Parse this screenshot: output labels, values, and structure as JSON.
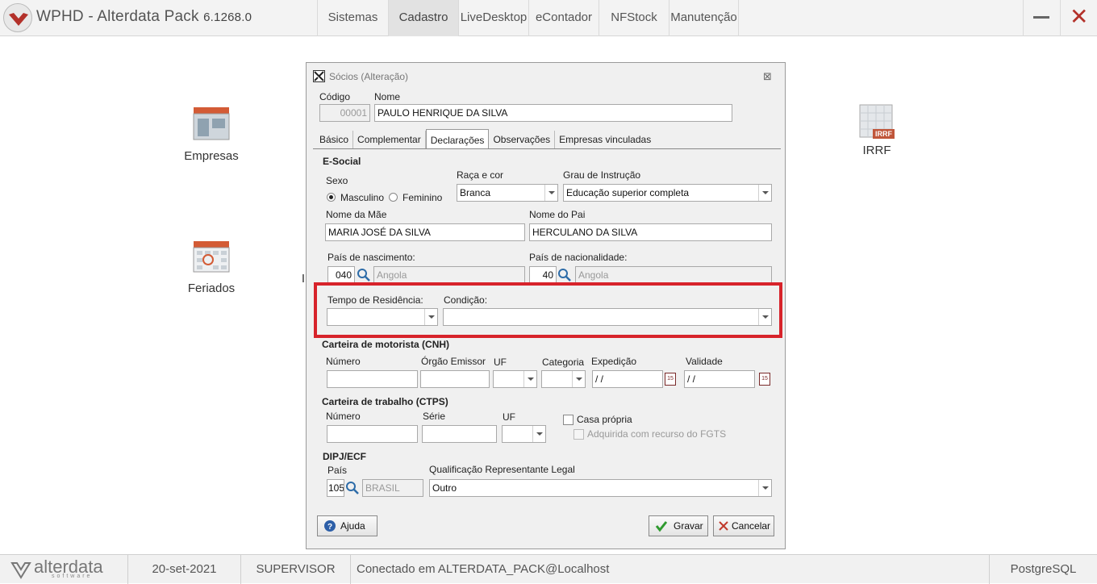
{
  "app": {
    "title": "WPHD - Alterdata Pack",
    "version": "6.1268.0",
    "brand_color": "#b3312a"
  },
  "menu": [
    "Sistemas",
    "Cadastro",
    "LiveDesktop",
    "eContador",
    "NFStock",
    "Manutenção"
  ],
  "menu_active": "Cadastro",
  "desktop_icons": {
    "empresas": "Empresas",
    "feriados": "Feriados",
    "irrf": "IRRF",
    "irrf_badge": "IRRF",
    "partial": "I"
  },
  "dialog": {
    "title": "Sócios (Alteração)",
    "codigo_label": "Código",
    "codigo_value": "00001",
    "nome_label": "Nome",
    "nome_value": "PAULO HENRIQUE DA SILVA",
    "tabs": [
      "Básico",
      "Complementar",
      "Declarações",
      "Observações",
      "Empresas vinculadas"
    ],
    "active_tab": "Declarações",
    "esocial": {
      "section": "E-Social",
      "sexo_label": "Sexo",
      "sexo_options": [
        "Masculino",
        "Feminino"
      ],
      "sexo_selected": "Masculino",
      "raca_label": "Raça e cor",
      "raca_value": "Branca",
      "grau_label": "Grau de Instrução",
      "grau_value": "Educação superior completa",
      "mae_label": "Nome da Mãe",
      "mae_value": "MARIA JOSÉ DA SILVA",
      "pai_label": "Nome do Pai",
      "pai_value": "HERCULANO DA SILVA",
      "pais_nasc_label": "País de nascimento:",
      "pais_nasc_code": "040",
      "pais_nasc_name": "Angola",
      "pais_nac_label": "País de nacionalidade:",
      "pais_nac_code": "40",
      "pais_nac_name": "Angola",
      "tempo_label": "Tempo de Residência:",
      "tempo_value": "",
      "condicao_label": "Condição:",
      "condicao_value": ""
    },
    "cnh": {
      "section": "Carteira de motorista (CNH)",
      "numero_label": "Número",
      "orgao_label": "Órgão Emissor",
      "uf_label": "UF",
      "categoria_label": "Categoria",
      "expedicao_label": "Expedição",
      "expedicao_value": " / /",
      "validade_label": "Validade",
      "validade_value": " / /",
      "cal_glyph": "15"
    },
    "ctps": {
      "section": "Carteira de trabalho (CTPS)",
      "numero_label": "Número",
      "serie_label": "Série",
      "uf_label": "UF",
      "casa_propria_label": "Casa própria",
      "fgts_label": "Adquirida com recurso do FGTS"
    },
    "dipj": {
      "section": "DIPJ/ECF",
      "pais_label": "País",
      "pais_code": "105",
      "pais_name": "BRASIL",
      "qualif_label": "Qualificação Representante Legal",
      "qualif_value": "Outro"
    },
    "buttons": {
      "ajuda": "Ajuda",
      "gravar": "Gravar",
      "cancelar": "Cancelar"
    },
    "highlight_color": "#d7232b"
  },
  "statusbar": {
    "logo_text": "alterdata",
    "logo_sub": "software",
    "date": "20-set-2021",
    "user": "SUPERVISOR",
    "connection": "Conectado em ALTERDATA_PACK@Localhost",
    "db": "PostgreSQL"
  }
}
